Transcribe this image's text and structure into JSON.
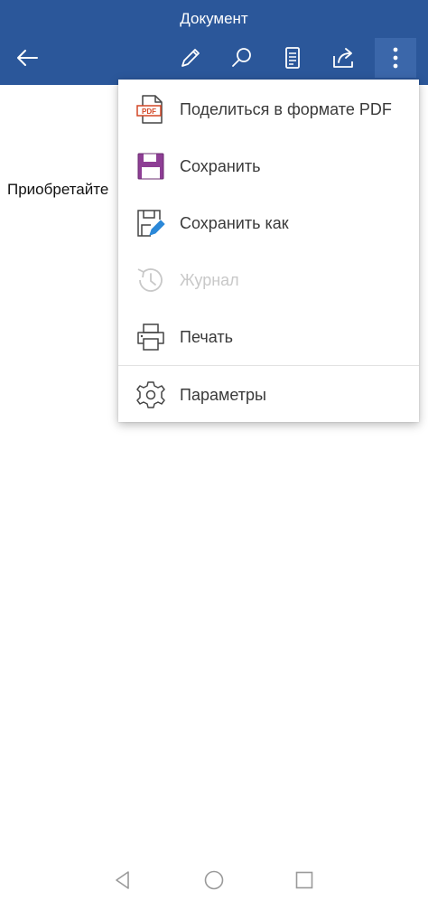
{
  "app_bar": {
    "title": "Документ",
    "background": "#2b579a",
    "icons": [
      "back-arrow-icon",
      "pencil-icon",
      "search-icon",
      "reading-view-icon",
      "share-icon",
      "more-vertical-icon"
    ]
  },
  "document": {
    "text": "Приобретайте"
  },
  "menu": {
    "items": [
      {
        "label": "Поделиться в формате PDF",
        "icon": "pdf-icon",
        "enabled": true
      },
      {
        "label": "Сохранить",
        "icon": "save-icon",
        "enabled": true
      },
      {
        "label": "Сохранить как",
        "icon": "save-as-icon",
        "enabled": true
      },
      {
        "label": "Журнал",
        "icon": "history-icon",
        "enabled": false
      },
      {
        "label": "Печать",
        "icon": "print-icon",
        "enabled": true
      },
      {
        "label": "Параметры",
        "icon": "settings-gear-icon",
        "enabled": true
      }
    ],
    "accent_pdf": "#d24726",
    "accent_save": "#8e3e95",
    "accent_save_as": "#2b88d8"
  },
  "nav_bar": {
    "icons": [
      "nav-back-icon",
      "nav-home-icon",
      "nav-recents-icon"
    ]
  }
}
